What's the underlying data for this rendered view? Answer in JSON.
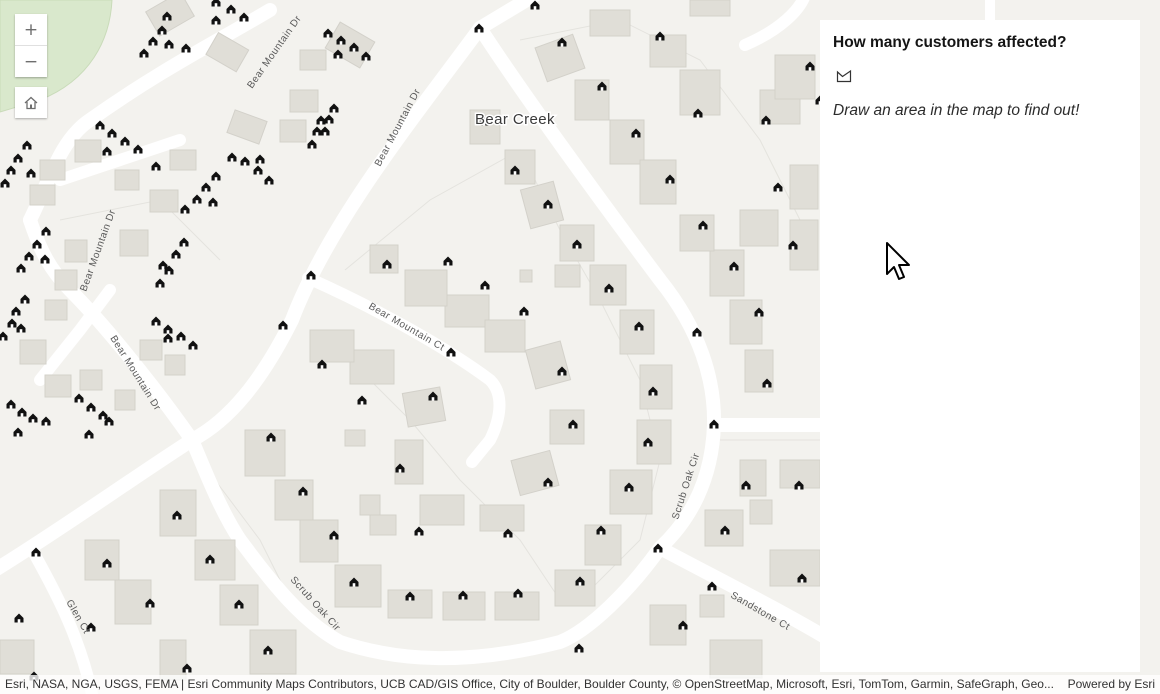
{
  "map": {
    "place_label": "Bear Creek",
    "street_labels": [
      {
        "text": "Bear Mountain Dr"
      },
      {
        "text": "Bear Mountain Dr"
      },
      {
        "text": "Bear Mountain Dr"
      },
      {
        "text": "Bear Mountain Dr"
      },
      {
        "text": "Bear Mountain Ct"
      },
      {
        "text": "Scrub Oak Cir"
      },
      {
        "text": "Scrub Oak Cir"
      },
      {
        "text": "Sandstone Ct"
      },
      {
        "text": "Glen Ct"
      }
    ],
    "colors": {
      "land": "#f3f2ee",
      "road": "#ffffff",
      "building": "#e0ded7",
      "park": "#d9e8cc",
      "marker": "#111111"
    }
  },
  "controls": {
    "zoom_in": "+",
    "zoom_out": "−",
    "home_icon": "home-icon"
  },
  "panel": {
    "title": "How many customers affected?",
    "draw_icon": "polygon-draw-icon",
    "hint": "Draw an area in the map to find out!"
  },
  "attribution": {
    "credits": "Esri, NASA, NGA, USGS, FEMA | Esri Community Maps Contributors, UCB CAD/GIS Office, City of Boulder, Boulder County, © OpenStreetMap, Microsoft, Esri, TomTom, Garmin, SafeGraph, Geo...",
    "powered": "Powered by Esri"
  }
}
